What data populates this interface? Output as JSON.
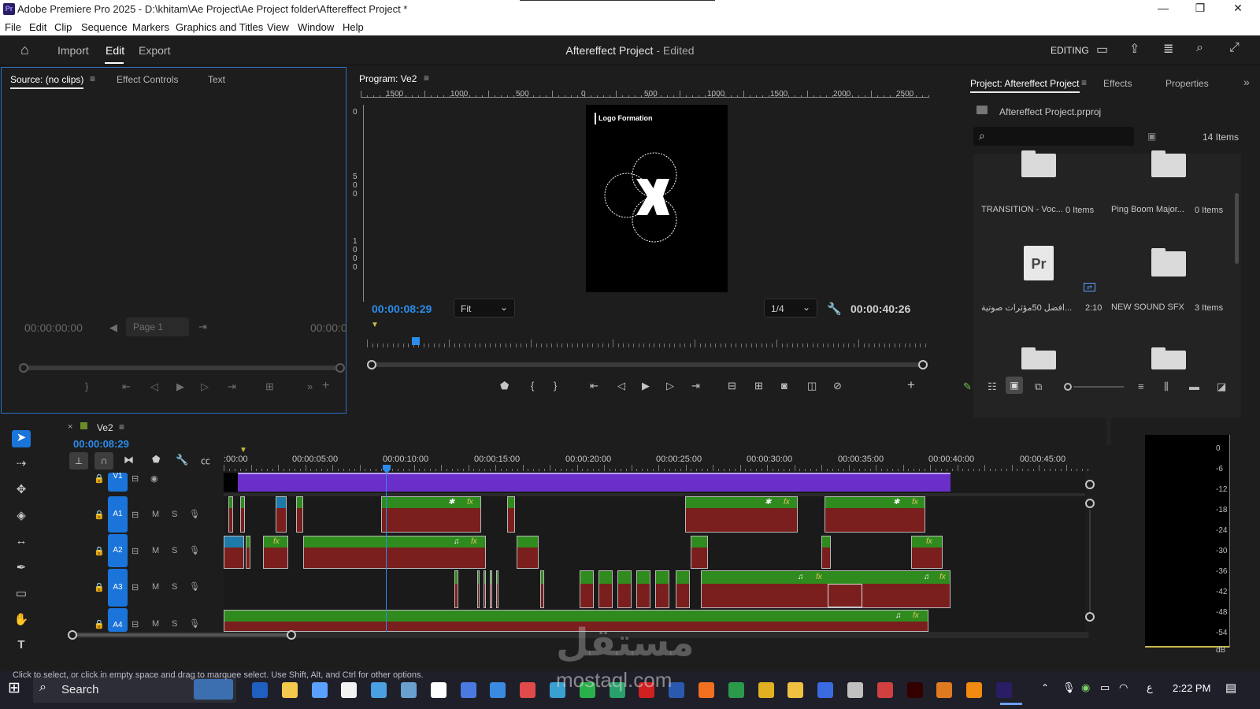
{
  "titlebar": {
    "app_logo_text": "Pr",
    "title": "Adobe Premiere Pro 2025 - D:\\khitam\\Ae Project\\Ae Project folder\\Aftereffect Project *",
    "minimize": "—",
    "maximize": "❐",
    "close": "✕"
  },
  "menu": [
    "File",
    "Edit",
    "Clip",
    "Sequence",
    "Markers",
    "Graphics and Titles",
    "View",
    "Window",
    "Help"
  ],
  "header": {
    "home_icon": "home-icon",
    "nav": [
      "Import",
      "Edit",
      "Export"
    ],
    "active_nav": "Edit",
    "doc_title": "Aftereffect Project",
    "doc_status": "- Edited",
    "workspace_label": "EDITING"
  },
  "source_panel": {
    "tabs": [
      "Source: (no clips)",
      "Effect Controls",
      "Text"
    ],
    "timecode_left": "00:00:00:00",
    "page_label": "Page 1",
    "timecode_right": "00:00:0"
  },
  "program_panel": {
    "tab": "Program: Ve2",
    "ruler_labels": [
      "1500",
      "1000",
      "500",
      "0",
      "500",
      "1000",
      "1500",
      "2000",
      "2500"
    ],
    "vruler_labels": [
      "0",
      "5",
      "0",
      "0",
      "1",
      "0",
      "0",
      "0"
    ],
    "preview_text": "Logo Formation",
    "timecode": "00:00:08:29",
    "fit": "Fit",
    "resolution": "1/4",
    "duration": "00:00:40:26"
  },
  "project_panel": {
    "tabs": [
      "Project: Aftereffect Project",
      "Effects",
      "Properties"
    ],
    "file_name": "Aftereffect Project.prproj",
    "search_placeholder": "",
    "item_count": "14 Items",
    "items": [
      {
        "name": "TRANSITION - Voc...",
        "count": "0 Items"
      },
      {
        "name": "Ping Boom Major...",
        "count": "0 Items"
      },
      {
        "name": "افضل 50مؤثرات صوتية...",
        "count": "2:10"
      },
      {
        "name": "NEW SOUND SFX",
        "count": "3 Items"
      }
    ]
  },
  "timeline": {
    "sequence_name": "Ve2",
    "timecode": "00:00:08:29",
    "ruler_labels": [
      ":00:00",
      "00:00:05:00",
      "00:00:10:00",
      "00:00:15:00",
      "00:00:20:00",
      "00:00:25:00",
      "00:00:30:00",
      "00:00:35:00",
      "00:00:40:00",
      "00:00:45:00"
    ],
    "tracks": [
      {
        "name": "V1",
        "m": "",
        "s": ""
      },
      {
        "name": "A1",
        "m": "M",
        "s": "S"
      },
      {
        "name": "A2",
        "m": "M",
        "s": "S"
      },
      {
        "name": "A3",
        "m": "M",
        "s": "S"
      },
      {
        "name": "A4",
        "m": "M",
        "s": "S"
      }
    ],
    "fx_label": "fx",
    "meter_labels": [
      "0",
      "-6",
      "-12",
      "-18",
      "-24",
      "-30",
      "-36",
      "-42",
      "-48",
      "-54",
      "dB"
    ]
  },
  "status_bar": {
    "text": "Click to select, or click in empty space and drag to marquee select. Use Shift, Alt, and Ctrl for other options."
  },
  "taskbar": {
    "search_label": "Search",
    "time": "2:22 PM",
    "input_lang": "ع"
  },
  "colors": {
    "accent": "#2d8ceb",
    "clip_green": "#2f8b1d",
    "clip_red": "#7a1e1e",
    "video_clip": "#6a2fc9"
  }
}
